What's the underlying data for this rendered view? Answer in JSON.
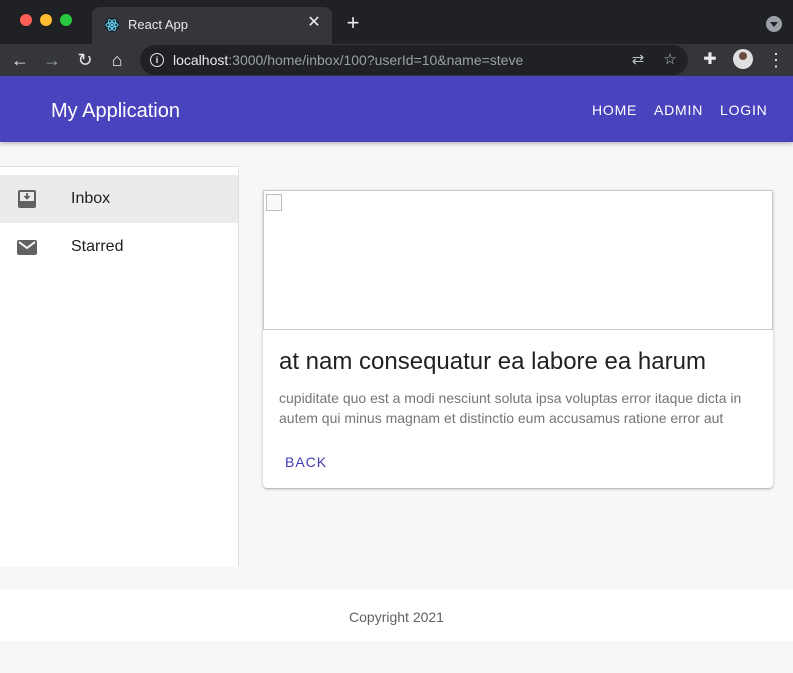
{
  "browser": {
    "tab_title": "React App",
    "url_host": "localhost",
    "url_rest": ":3000/home/inbox/100?userId=10&name=steve"
  },
  "appbar": {
    "title": "My Application",
    "nav": [
      "HOME",
      "ADMIN",
      "LOGIN"
    ],
    "color": "#4a43be"
  },
  "sidebar": {
    "items": [
      {
        "label": "Inbox",
        "icon": "move-to-inbox-icon",
        "active": true
      },
      {
        "label": "Starred",
        "icon": "mail-icon",
        "active": false
      }
    ]
  },
  "card": {
    "title": "at nam consequatur ea labore ea harum",
    "body": "cupiditate quo est a modi nesciunt soluta ipsa voluptas error itaque dicta in autem qui minus magnam et distinctio eum accusamus ratione error aut",
    "action": "BACK"
  },
  "footer": {
    "text": "Copyright 2021"
  }
}
